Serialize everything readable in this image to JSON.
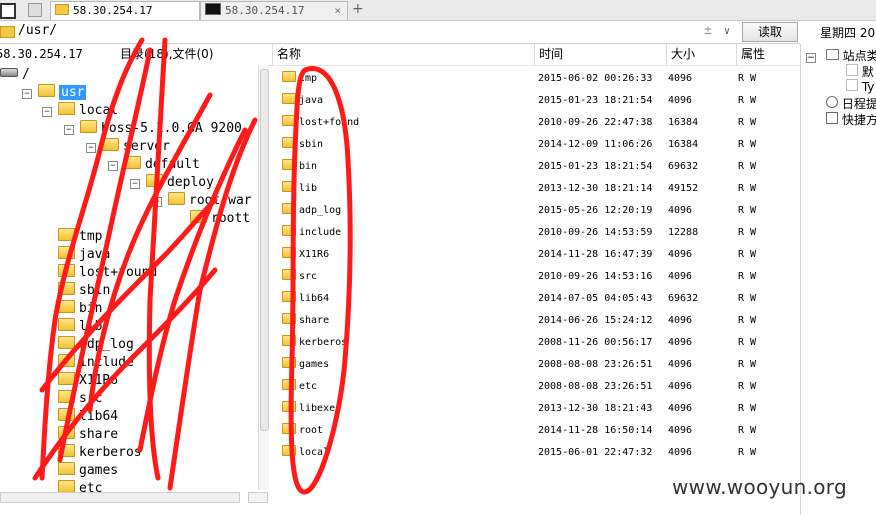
{
  "tabs": [
    {
      "label": "58.30.254.17",
      "type": "folder",
      "active": true
    },
    {
      "label": "58.30.254.17",
      "type": "terminal",
      "active": false
    }
  ],
  "toolbar": {
    "add_tab": "+",
    "filter_symbol": "±",
    "read_label": "读取",
    "weekday": "星期四 20"
  },
  "path": {
    "value": "/usr/"
  },
  "left": {
    "host": "58.30.254.17",
    "summary": "目录(18),文件(0)"
  },
  "tree": [
    {
      "label": "/",
      "icon": "drive-icon",
      "level": 0
    },
    {
      "label": "usr",
      "level": 1,
      "selected": true
    },
    {
      "label": "local",
      "level": 2
    },
    {
      "label": "boss-5.1.0.GA 9200",
      "level": 3
    },
    {
      "label": "server",
      "level": 4
    },
    {
      "label": "default",
      "level": 5
    },
    {
      "label": "deploy",
      "level": 6
    },
    {
      "label": "root.war",
      "level": 7
    },
    {
      "label": "roott",
      "level": 8
    },
    {
      "label": "tmp",
      "level": 2
    },
    {
      "label": "java",
      "level": 2
    },
    {
      "label": "lost+found",
      "level": 2
    },
    {
      "label": "sbin",
      "level": 2
    },
    {
      "label": "bin",
      "level": 2
    },
    {
      "label": "lib",
      "level": 2
    },
    {
      "label": "adp_log",
      "level": 2
    },
    {
      "label": "include",
      "level": 2
    },
    {
      "label": "X11R6",
      "level": 2
    },
    {
      "label": "src",
      "level": 2
    },
    {
      "label": "lib64",
      "level": 2
    },
    {
      "label": "share",
      "level": 2
    },
    {
      "label": "kerberos",
      "level": 2
    },
    {
      "label": "games",
      "level": 2
    },
    {
      "label": "etc",
      "level": 2
    }
  ],
  "columns": {
    "name": "名称",
    "time": "时间",
    "size": "大小",
    "attr": "属性"
  },
  "files": [
    {
      "name": "tmp",
      "time": "2015-06-02 00:26:33",
      "size": "4096",
      "attr": "R W"
    },
    {
      "name": "java",
      "time": "2015-01-23 18:21:54",
      "size": "4096",
      "attr": "R W"
    },
    {
      "name": "lost+found",
      "time": "2010-09-26 22:47:38",
      "size": "16384",
      "attr": "R W"
    },
    {
      "name": "sbin",
      "time": "2014-12-09 11:06:26",
      "size": "16384",
      "attr": "R W"
    },
    {
      "name": "bin",
      "time": "2015-01-23 18:21:54",
      "size": "69632",
      "attr": "R W"
    },
    {
      "name": "lib",
      "time": "2013-12-30 18:21:14",
      "size": "49152",
      "attr": "R W"
    },
    {
      "name": "adp_log",
      "time": "2015-05-26 12:20:19",
      "size": "4096",
      "attr": "R W"
    },
    {
      "name": "include",
      "time": "2010-09-26 14:53:59",
      "size": "12288",
      "attr": "R W"
    },
    {
      "name": "X11R6",
      "time": "2014-11-28 16:47:39",
      "size": "4096",
      "attr": "R W"
    },
    {
      "name": "src",
      "time": "2010-09-26 14:53:16",
      "size": "4096",
      "attr": "R W"
    },
    {
      "name": "lib64",
      "time": "2014-07-05 04:05:43",
      "size": "69632",
      "attr": "R W"
    },
    {
      "name": "share",
      "time": "2014-06-26 15:24:12",
      "size": "4096",
      "attr": "R W"
    },
    {
      "name": "kerberos",
      "time": "2008-11-26 00:56:17",
      "size": "4096",
      "attr": "R W"
    },
    {
      "name": "games",
      "time": "2008-08-08 23:26:51",
      "size": "4096",
      "attr": "R W"
    },
    {
      "name": "etc",
      "time": "2008-08-08 23:26:51",
      "size": "4096",
      "attr": "R W"
    },
    {
      "name": "libexec",
      "time": "2013-12-30 18:21:43",
      "size": "4096",
      "attr": "R W"
    },
    {
      "name": "root",
      "time": "2014-11-28 16:50:14",
      "size": "4096",
      "attr": "R W"
    },
    {
      "name": "local",
      "time": "2015-06-01 22:47:32",
      "size": "4096",
      "attr": "R W"
    }
  ],
  "right_panel": {
    "items": [
      {
        "label": "站点类",
        "icon": "site-icon"
      },
      {
        "label": "默",
        "icon": "checkbox-icon"
      },
      {
        "label": "Ty",
        "icon": "checkbox-icon"
      },
      {
        "label": "日程提",
        "icon": "schedule-icon"
      },
      {
        "label": "快捷方",
        "icon": "shortcut-icon"
      }
    ]
  },
  "watermark": "www.wooyun.org",
  "colors": {
    "scribble": "#ff1a1a",
    "selection": "#3399ff",
    "folder": "#f2c233"
  }
}
